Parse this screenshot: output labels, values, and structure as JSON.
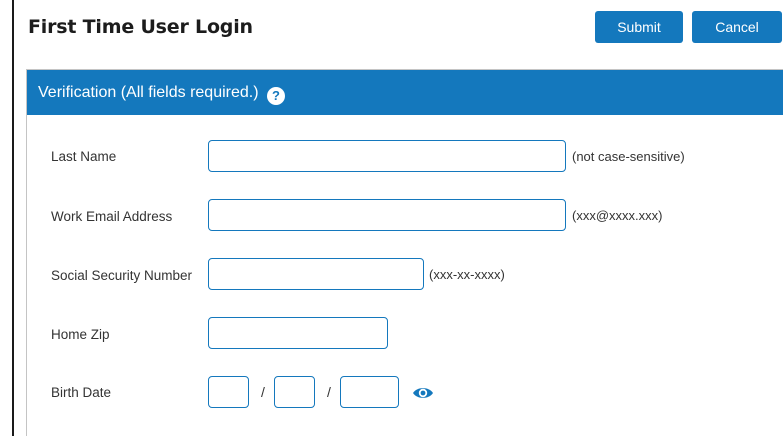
{
  "header": {
    "title": "First Time User Login",
    "submit_label": "Submit",
    "cancel_label": "Cancel"
  },
  "panel": {
    "title": "Verification (All fields required.)",
    "help_icon": "question-circle-icon"
  },
  "fields": {
    "last_name": {
      "label": "Last Name",
      "value": "",
      "hint": "(not case-sensitive)"
    },
    "work_email": {
      "label": "Work Email Address",
      "value": "",
      "hint": "(xxx@xxxx.xxx)"
    },
    "ssn": {
      "label": "Social Security Number",
      "value": "",
      "hint": "(xxx-xx-xxxx)"
    },
    "home_zip": {
      "label": "Home Zip",
      "value": ""
    },
    "birth_date": {
      "label": "Birth Date",
      "month": "",
      "day": "",
      "year": "",
      "separator": "/",
      "visibility_icon": "eye-icon"
    }
  },
  "colors": {
    "accent": "#1478bd",
    "header_text": "#ffffff",
    "label_text": "#333333"
  }
}
